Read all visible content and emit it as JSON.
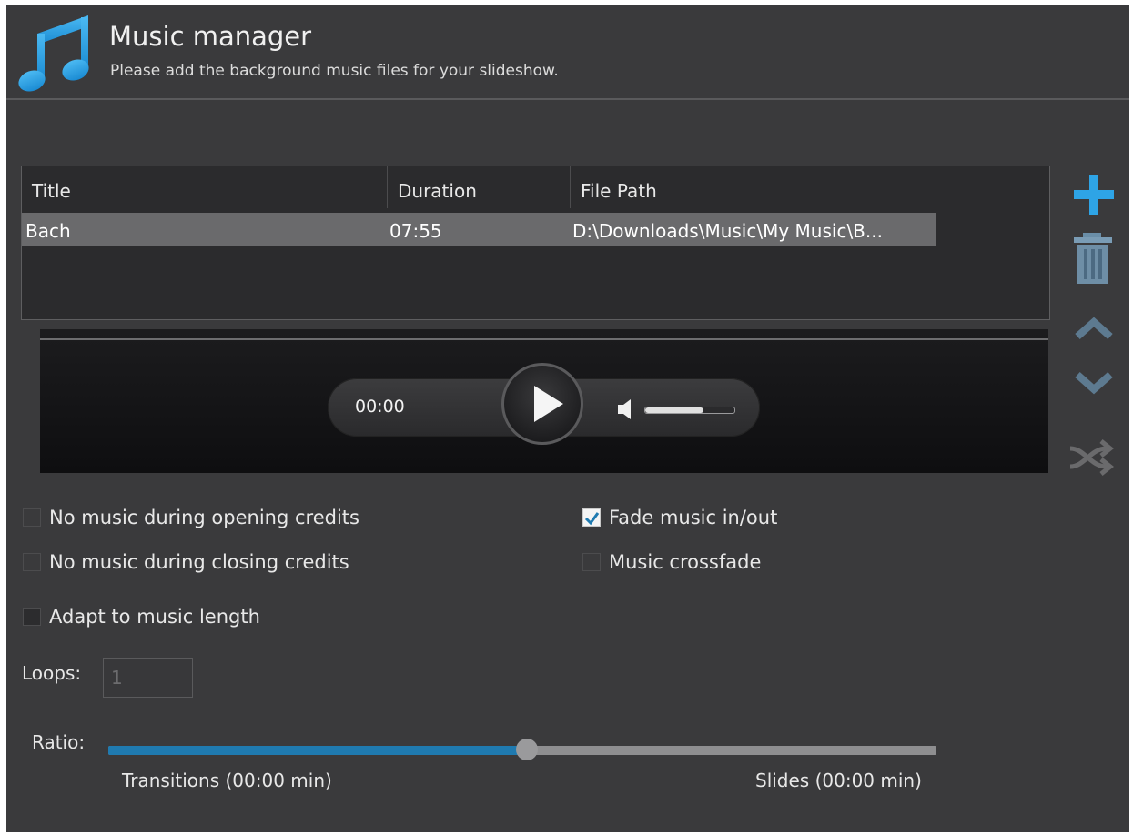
{
  "header": {
    "title": "Music manager",
    "subtitle": "Please add the background music files for your slideshow.",
    "icon": "music-note-icon",
    "icon_color": "#2ea4e6"
  },
  "table": {
    "columns": [
      "Title",
      "Duration",
      "File Path"
    ],
    "rows": [
      {
        "title": "Bach",
        "duration": "07:55",
        "path": "D:\\Downloads\\Music\\My Music\\B...",
        "selected": true
      }
    ]
  },
  "tools": {
    "add": "plus-icon",
    "delete": "trash-icon",
    "move_up": "chevron-up-icon",
    "move_down": "chevron-down-icon",
    "shuffle": "shuffle-icon",
    "accent": "#2ea4e6"
  },
  "player": {
    "time": "00:00",
    "volume_level": 0.65
  },
  "options": {
    "no_music_opening": {
      "label": "No music during opening credits",
      "checked": false
    },
    "no_music_closing": {
      "label": "No music during closing credits",
      "checked": false
    },
    "adapt_length": {
      "label": "Adapt to music length",
      "checked": false
    },
    "fade": {
      "label": "Fade music in/out",
      "checked": true
    },
    "crossfade": {
      "label": "Music crossfade",
      "checked": false
    }
  },
  "loops": {
    "label": "Loops:",
    "value": "1"
  },
  "ratio": {
    "label": "Ratio:",
    "value": 0.505,
    "left_label": "Transitions (00:00 min)",
    "right_label": "Slides (00:00 min)",
    "fill_color": "#1f7ab0"
  }
}
